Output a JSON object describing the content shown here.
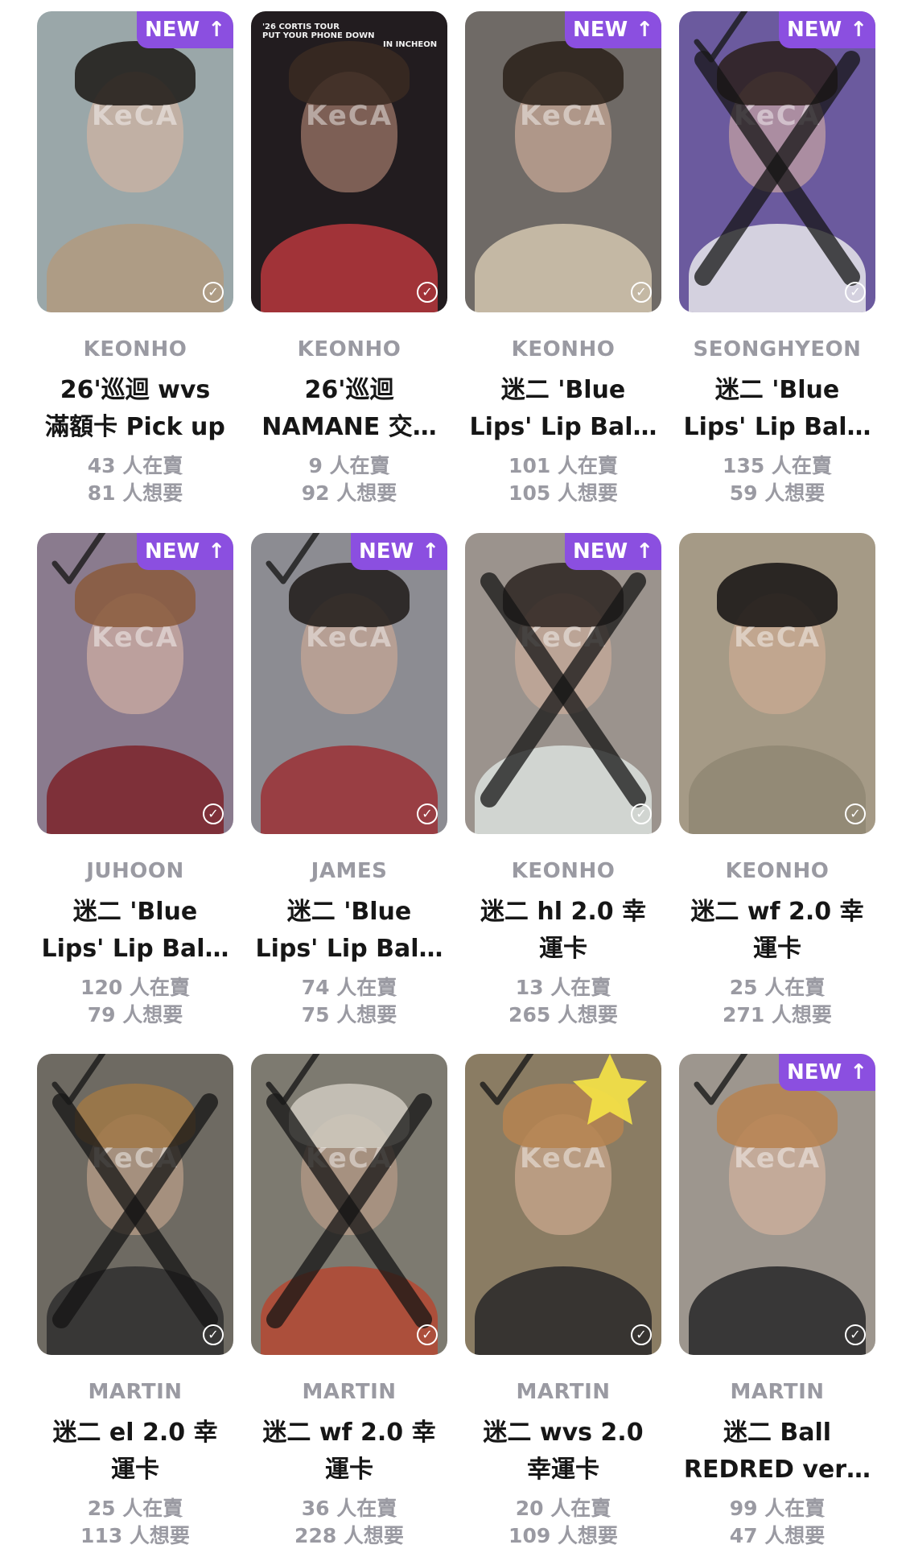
{
  "badge": {
    "new_label": "NEW",
    "new_arrow": "↑",
    "check_glyph": "✓"
  },
  "watermark": "KeCA",
  "cards": [
    {
      "member": "KEONHO",
      "title_l1": "26'巡迴 wvs",
      "title_l2": "滿額卡 Pick up",
      "sellers": "43 人在賣",
      "wanters": "81 人想要",
      "is_new": true,
      "crossed": false,
      "ticked": false,
      "colors": {
        "bg": "#9aa7a9",
        "hair": "#1b1714",
        "skin": "#e2b8a0",
        "body": "#b39a7c"
      }
    },
    {
      "member": "KEONHO",
      "title_l1": "26'巡迴",
      "title_l2": "NAMANE 交…",
      "sellers": "9 人在賣",
      "wanters": "92 人想要",
      "is_new": false,
      "crossed": false,
      "ticked": false,
      "caption_l1": "'26 CORTIS TOUR",
      "caption_l2": "PUT YOUR PHONE DOWN",
      "caption_l3": "IN INCHEON",
      "colors": {
        "bg": "#221c1f",
        "hair": "#3a2a22",
        "skin": "#c89882",
        "body": "#c23a3f"
      }
    },
    {
      "member": "KEONHO",
      "title_l1": "迷二 'Blue",
      "title_l2": "Lips' Lip Bal…",
      "sellers": "101 人在賣",
      "wanters": "105 人想要",
      "is_new": true,
      "crossed": false,
      "ticked": false,
      "colors": {
        "bg": "#6f6a66",
        "hair": "#2a2019",
        "skin": "#e3bba6",
        "body": "#d9ccb4"
      }
    },
    {
      "member": "SEONGHYEON",
      "title_l1": "迷二 'Blue",
      "title_l2": "Lips' Lip Bal…",
      "sellers": "135 人在賣",
      "wanters": "59 人想要",
      "is_new": true,
      "crossed": true,
      "ticked": true,
      "colors": {
        "bg": "#6b5a9e",
        "hair": "#2a1e1a",
        "skin": "#e0b8a4",
        "body": "#efefef"
      }
    },
    {
      "member": "JUHOON",
      "title_l1": "迷二 'Blue",
      "title_l2": "Lips' Lip Bal…",
      "sellers": "120 人在賣",
      "wanters": "79 人想要",
      "is_new": true,
      "crossed": false,
      "ticked": true,
      "colors": {
        "bg": "#8a7b8e",
        "hair": "#8a5a3c",
        "skin": "#e6c0aa",
        "body": "#7a1e24"
      }
    },
    {
      "member": "JAMES",
      "title_l1": "迷二 'Blue",
      "title_l2": "Lips' Lip Bal…",
      "sellers": "74 人在賣",
      "wanters": "75 人想要",
      "is_new": true,
      "crossed": false,
      "ticked": true,
      "colors": {
        "bg": "#8c8c92",
        "hair": "#1e1a18",
        "skin": "#d8ae96",
        "body": "#9c2a30"
      }
    },
    {
      "member": "KEONHO",
      "title_l1": "迷二 hl 2.0 幸",
      "title_l2": "運卡",
      "sellers": "13 人在賣",
      "wanters": "265 人想要",
      "is_new": true,
      "crossed": true,
      "ticked": false,
      "colors": {
        "bg": "#9b938d",
        "hair": "#2b2320",
        "skin": "#d6b39e",
        "body": "#dfe6e2"
      }
    },
    {
      "member": "KEONHO",
      "title_l1": "迷二 wf 2.0 幸",
      "title_l2": "運卡",
      "sellers": "25 人在賣",
      "wanters": "271 人想要",
      "is_new": false,
      "crossed": false,
      "ticked": false,
      "colors": {
        "bg": "#a59a86",
        "hair": "#141212",
        "skin": "#d8b098",
        "body": "#8f8672"
      }
    },
    {
      "member": "MARTIN",
      "title_l1": "迷二 el 2.0 幸",
      "title_l2": "運卡",
      "sellers": "25 人在賣",
      "wanters": "113 人想要",
      "is_new": false,
      "crossed": true,
      "ticked": true,
      "colors": {
        "bg": "#6e6a62",
        "hair": "#a07846",
        "skin": "#d4ae96",
        "body": "#2a2a2c"
      }
    },
    {
      "member": "MARTIN",
      "title_l1": "迷二 wf 2.0 幸",
      "title_l2": "運卡",
      "sellers": "36 人在賣",
      "wanters": "228 人想要",
      "is_new": false,
      "crossed": true,
      "ticked": true,
      "colors": {
        "bg": "#7d7a70",
        "hair": "#cfcac0",
        "skin": "#c9a48e",
        "body": "#b8452e"
      }
    },
    {
      "member": "MARTIN",
      "title_l1": "迷二 wvs 2.0",
      "title_l2": "幸運卡",
      "sellers": "20 人在賣",
      "wanters": "109 人想要",
      "is_new": false,
      "crossed": false,
      "ticked": true,
      "star": true,
      "colors": {
        "bg": "#8a7c63",
        "hair": "#b58450",
        "skin": "#e0b69c",
        "body": "#222224"
      }
    },
    {
      "member": "MARTIN",
      "title_l1": "迷二 Ball",
      "title_l2": "REDRED ver…",
      "sellers": "99 人在賣",
      "wanters": "47 人想要",
      "is_new": true,
      "crossed": false,
      "ticked": true,
      "colors": {
        "bg": "#9d968e",
        "hair": "#b78250",
        "skin": "#e2bba2",
        "body": "#1f1f22"
      }
    }
  ]
}
